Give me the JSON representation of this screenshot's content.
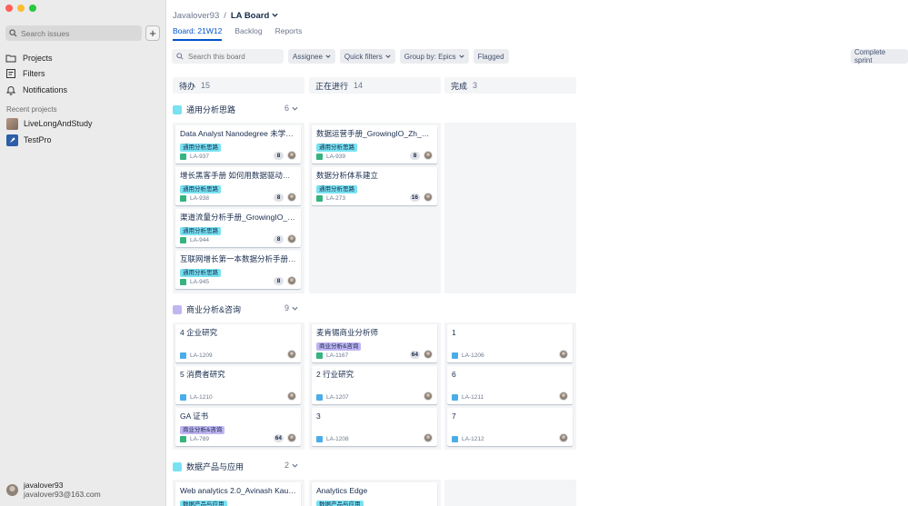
{
  "sidebar": {
    "search_placeholder": "Search issues",
    "add_label": "+",
    "nav": [
      {
        "label": "Projects",
        "icon": "folder-icon"
      },
      {
        "label": "Filters",
        "icon": "filter-icon"
      },
      {
        "label": "Notifications",
        "icon": "bell-icon"
      }
    ],
    "recent_title": "Recent projects",
    "recent": [
      {
        "label": "LiveLongAndStudy"
      },
      {
        "label": "TestPro"
      }
    ],
    "user": {
      "name": "javalover93",
      "email": "javalover93@163.com"
    }
  },
  "header": {
    "breadcrumb_owner": "Javalover93",
    "breadcrumb_sep": "/",
    "board_name": "LA Board",
    "tabs": [
      "Board: 21W12",
      "Backlog",
      "Reports"
    ]
  },
  "toolbar": {
    "search_placeholder": "Search this board",
    "assignee": "Assignee",
    "quick_filters": "Quick filters",
    "group_by": "Group by: Epics",
    "flagged": "Flagged",
    "complete_sprint": "Complete sprint"
  },
  "columns": [
    {
      "title": "待办",
      "count": "15"
    },
    {
      "title": "正在进行",
      "count": "14"
    },
    {
      "title": "完成",
      "count": "3"
    }
  ],
  "colors": {
    "epic_teal": "#79e2f2",
    "epic_purple": "#c0b6f2",
    "accent": "#0052cc"
  },
  "swimlanes": [
    {
      "title": "通用分析思路",
      "count": "6",
      "cards": [
        {
          "col": 0,
          "title": "Data Analyst Nanodegree 未学完...",
          "epic": "通用分析思路",
          "key": "LA-937",
          "estimate": "8",
          "type": "story"
        },
        {
          "col": 0,
          "title": "增长黑客手册 如何用数据驱动爆...",
          "epic": "通用分析思路",
          "key": "LA-938",
          "estimate": "8",
          "type": "story"
        },
        {
          "col": 0,
          "title": "渠道流量分析手册_GrowingIO_Zh...",
          "epic": "通用分析思路",
          "key": "LA-944",
          "estimate": "8",
          "type": "story"
        },
        {
          "col": 0,
          "title": "互联网增长第一本数据分析手册_...",
          "epic": "通用分析思路",
          "key": "LA-945",
          "estimate": "8",
          "type": "story"
        },
        {
          "col": 1,
          "title": "数据运营手册_GrowingIO_Zh_2017",
          "epic": "通用分析思路",
          "key": "LA-939",
          "estimate": "8",
          "type": "story"
        },
        {
          "col": 1,
          "title": "数据分析体系建立",
          "epic": "通用分析思路",
          "key": "LA-273",
          "estimate": "16",
          "type": "story"
        }
      ]
    },
    {
      "title": "商业分析&咨询",
      "count": "9",
      "cards": [
        {
          "col": 0,
          "title": "4 企业研究",
          "epic": "",
          "key": "LA-1209",
          "estimate": "",
          "type": "task"
        },
        {
          "col": 0,
          "title": "5 消费者研究",
          "epic": "",
          "key": "LA-1210",
          "estimate": "",
          "type": "task"
        },
        {
          "col": 0,
          "title": "GA 证书",
          "epic": "商业分析&咨询",
          "key": "LA-789",
          "estimate": "64",
          "type": "story"
        },
        {
          "col": 1,
          "title": "麦肯锡商业分析师",
          "epic": "商业分析&咨询",
          "key": "LA-1167",
          "estimate": "64",
          "type": "story"
        },
        {
          "col": 1,
          "title": "2 行业研究",
          "epic": "",
          "key": "LA-1207",
          "estimate": "",
          "type": "task"
        },
        {
          "col": 1,
          "title": "3",
          "epic": "",
          "key": "LA-1208",
          "estimate": "",
          "type": "task"
        },
        {
          "col": 2,
          "title": "1",
          "epic": "",
          "key": "LA-1206",
          "estimate": "",
          "type": "task"
        },
        {
          "col": 2,
          "title": "6",
          "epic": "",
          "key": "LA-1211",
          "estimate": "",
          "type": "task"
        },
        {
          "col": 2,
          "title": "7",
          "epic": "",
          "key": "LA-1212",
          "estimate": "",
          "type": "task"
        }
      ]
    },
    {
      "title": "数据产品与应用",
      "count": "2",
      "cards": [
        {
          "col": 0,
          "title": "Web analytics 2.0_Avinash Kaushik...",
          "epic": "数据产品与应用",
          "key": "",
          "estimate": "",
          "type": "story"
        },
        {
          "col": 1,
          "title": "Analytics Edge",
          "epic": "数据产品与应用",
          "key": "",
          "estimate": "",
          "type": "story"
        }
      ]
    }
  ]
}
